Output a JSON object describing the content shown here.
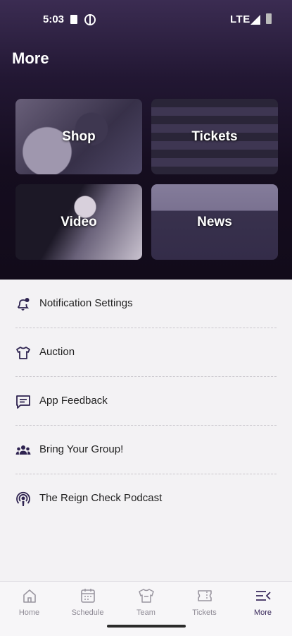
{
  "status": {
    "time": "5:03",
    "network": "LTE"
  },
  "header": {
    "title": "More"
  },
  "tiles": [
    {
      "label": "Shop"
    },
    {
      "label": "Tickets"
    },
    {
      "label": "Video"
    },
    {
      "label": "News"
    }
  ],
  "menu": [
    {
      "label": "Notification Settings",
      "icon": "bell-gear-icon"
    },
    {
      "label": "Auction",
      "icon": "jersey-icon"
    },
    {
      "label": "App Feedback",
      "icon": "chat-icon"
    },
    {
      "label": "Bring Your Group!",
      "icon": "group-icon"
    },
    {
      "label": "The Reign Check Podcast",
      "icon": "podcast-icon"
    }
  ],
  "nav": [
    {
      "label": "Home",
      "icon": "home-icon"
    },
    {
      "label": "Schedule",
      "icon": "calendar-icon"
    },
    {
      "label": "Team",
      "icon": "jersey-icon"
    },
    {
      "label": "Tickets",
      "icon": "ticket-icon"
    },
    {
      "label": "More",
      "icon": "more-menu-icon",
      "active": true
    }
  ],
  "colors": {
    "accent": "#3a2a5c",
    "header_bg": "#150d1f",
    "list_bg": "#f3f2f4"
  }
}
